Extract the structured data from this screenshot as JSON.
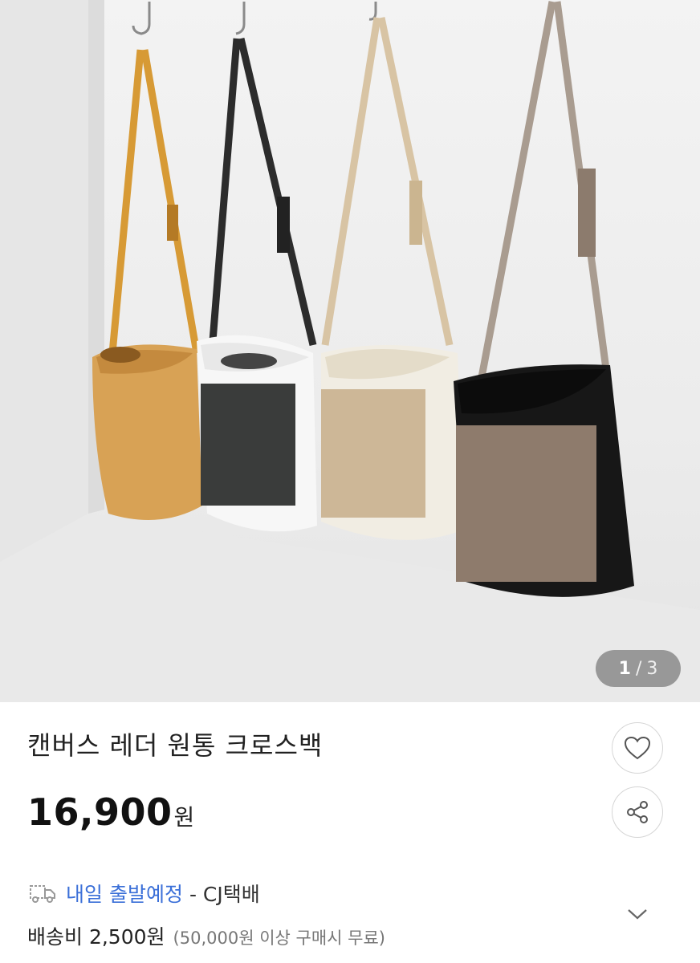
{
  "gallery": {
    "current": "1",
    "separator": "/",
    "total": "3"
  },
  "product": {
    "title": "캔버스 레더 원통 크로스백",
    "price": "16,900",
    "price_unit": "원"
  },
  "shipping": {
    "eta": "내일 출발예정",
    "carrier": "- CJ택배",
    "fee": "배송비 2,500원",
    "free_condition": "(50,000원 이상 구매시 무료)"
  },
  "colors": {
    "accent": "#3a6fd8"
  }
}
